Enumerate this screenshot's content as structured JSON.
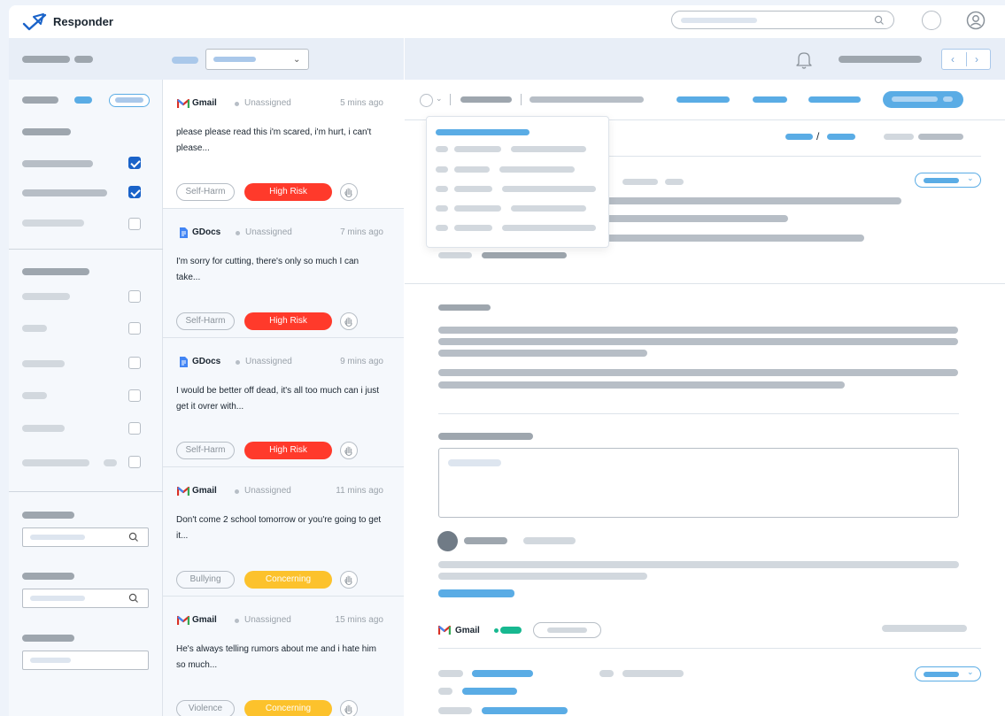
{
  "app": {
    "title": "Responder"
  },
  "colors": {
    "accent": "#5aace5",
    "primary": "#1a63c9",
    "high_risk": "#ff3a2b",
    "concerning": "#fcc22c",
    "online": "#17b890"
  },
  "icons": {
    "logo": "rocket-check-icon",
    "search": "search-icon",
    "user": "user-circle-icon",
    "bell": "bell-icon",
    "hand": "hand-icon",
    "gmail": "gmail-icon",
    "gdocs": "gdocs-icon"
  },
  "nav": {
    "prev": "‹",
    "next": "›",
    "dropdown_chevron": "⌄"
  },
  "alerts": [
    {
      "source": "Gmail",
      "assignee": "Unassigned",
      "time": "5 mins ago",
      "message": "please please read this i'm scared, i'm hurt, i can't please...",
      "category": "Self-Harm",
      "risk": "High Risk"
    },
    {
      "source": "GDocs",
      "assignee": "Unassigned",
      "time": "7 mins ago",
      "message": "I'm sorry for cutting, there's only so much I can take...",
      "category": "Self-Harm",
      "risk": "High Risk"
    },
    {
      "source": "GDocs",
      "assignee": "Unassigned",
      "time": "9 mins ago",
      "message": "I would be better off dead, it's all too much can i just get it ovrer with...",
      "category": "Self-Harm",
      "risk": "High Risk"
    },
    {
      "source": "Gmail",
      "assignee": "Unassigned",
      "time": "11 mins ago",
      "message": "Don't come 2 school tomorrow or you're going to get it...",
      "category": "Bullying",
      "risk": "Concerning"
    },
    {
      "source": "Gmail",
      "assignee": "Unassigned",
      "time": "15 mins ago",
      "message": "He's always telling rumors about me and i hate him so much...",
      "category": "Violence",
      "risk": "Concerning"
    }
  ],
  "detail": {
    "slash": "/",
    "email_source": "Gmail"
  }
}
